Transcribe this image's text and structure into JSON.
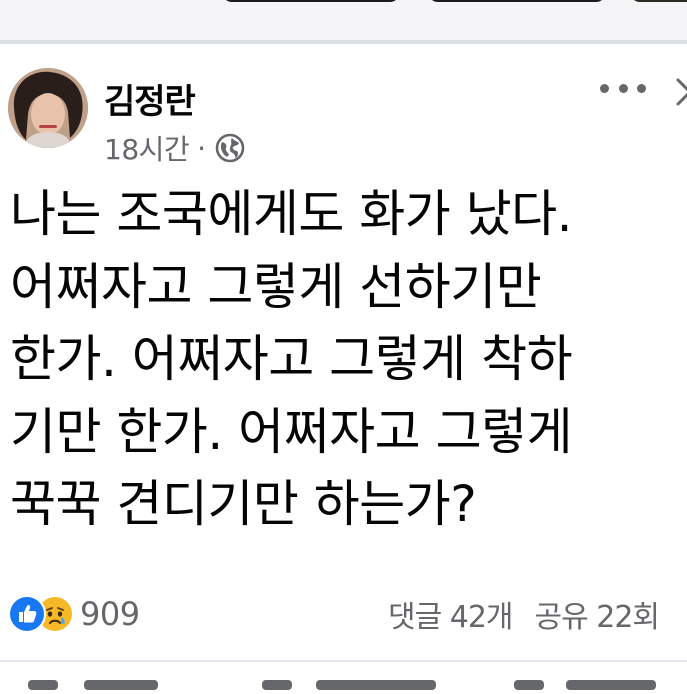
{
  "post": {
    "author": "김정란",
    "time": "18시간",
    "separator": "·",
    "privacy_icon": "globe-icon",
    "more_icon": "more-dots-icon",
    "close_icon": "close-icon",
    "text_lines": [
      "나는 조국에게도 화가 났다.",
      "어쩌자고 그렇게 선하기만",
      "한가. 어쩌자고 그렇게 착하",
      "기만 한가. 어쩌자고 그렇게",
      "꾹꾹 견디기만 하는가?"
    ]
  },
  "reactions": {
    "icons": [
      "like-icon",
      "sad-icon"
    ],
    "count": "909"
  },
  "counts": {
    "comments": "댓글 42개",
    "shares": "공유 22회"
  },
  "colors": {
    "primary_text": "#050505",
    "secondary_text": "#65676b",
    "like_blue": "#1877f2",
    "sad_yellow": "#f7b928",
    "divider": "#dcdfe3"
  }
}
